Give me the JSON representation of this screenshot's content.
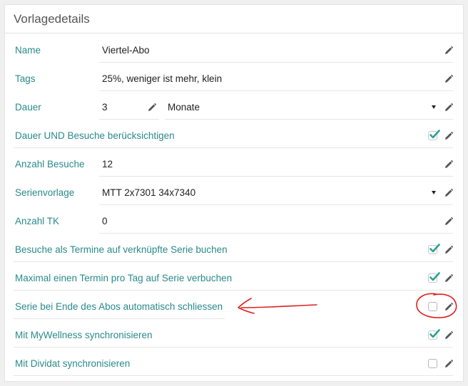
{
  "panel": {
    "title": "Vorlagedetails"
  },
  "icons": {
    "edit": "pencil-icon",
    "check": "check-icon",
    "dropdown": "caret-down-icon"
  },
  "colors": {
    "label": "#2a8a8a",
    "check": "#2aa198",
    "annotation": "#e02020"
  },
  "fields": {
    "name": {
      "label": "Name",
      "value": "Viertel-Abo"
    },
    "tags": {
      "label": "Tags",
      "value": "25%, weniger ist mehr, klein"
    },
    "dauer": {
      "label": "Dauer",
      "value": "3",
      "unit": "Monate"
    },
    "dauer_und_besuche": {
      "label": "Dauer UND Besuche berücksichtigen",
      "checked": true
    },
    "anzahl_besuche": {
      "label": "Anzahl Besuche",
      "value": "12"
    },
    "serienvorlage": {
      "label": "Serienvorlage",
      "value": "MTT 2x7301 34x7340"
    },
    "anzahl_tk": {
      "label": "Anzahl TK",
      "value": "0"
    },
    "besuche_termine": {
      "label": "Besuche als Termine auf verknüpfte Serie buchen",
      "checked": true
    },
    "max_termin": {
      "label": "Maximal einen Termin pro Tag auf Serie verbuchen",
      "checked": true
    },
    "serie_schliessen": {
      "label": "Serie bei Ende des Abos automatisch schliessen",
      "checked": false
    },
    "mywellness": {
      "label": "Mit MyWellness synchronisieren",
      "checked": true
    },
    "dividat": {
      "label": "Mit Dividat synchronisieren",
      "checked": false
    }
  }
}
